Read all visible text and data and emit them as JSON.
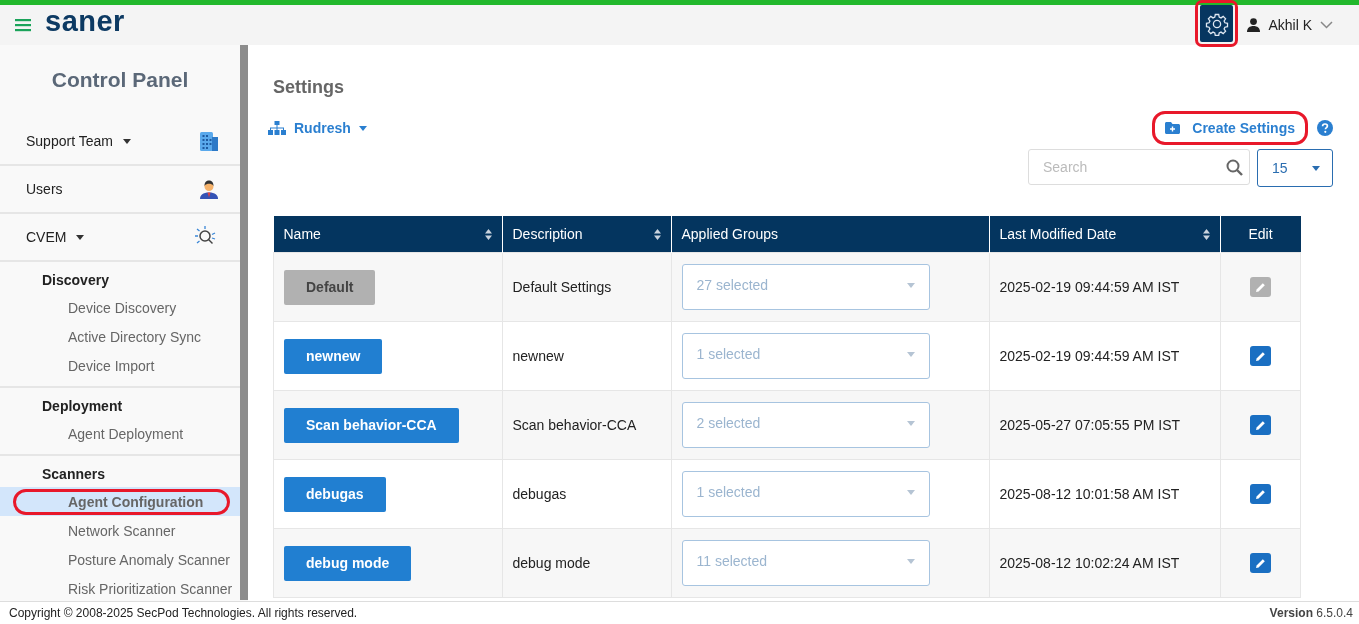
{
  "header": {
    "logo": "saner",
    "settings_highlighted": true,
    "user": "Akhil K"
  },
  "sidebar": {
    "title": "Control Panel",
    "items": [
      {
        "label": "Support Team",
        "caret": true,
        "selected": false
      },
      {
        "label": "Users",
        "caret": false,
        "selected": false
      },
      {
        "label": "CVEM",
        "caret": true,
        "selected": false
      }
    ],
    "groups": [
      {
        "label": "Discovery",
        "children": [
          {
            "label": "Device Discovery",
            "selected": false,
            "highlighted": false
          },
          {
            "label": "Active Directory Sync",
            "selected": false,
            "highlighted": false
          },
          {
            "label": "Device Import",
            "selected": false,
            "highlighted": false
          }
        ]
      },
      {
        "label": "Deployment",
        "children": [
          {
            "label": "Agent Deployment",
            "selected": false,
            "highlighted": false
          }
        ]
      },
      {
        "label": "Scanners",
        "children": [
          {
            "label": "Agent Configuration",
            "selected": true,
            "highlighted": true
          },
          {
            "label": "Network Scanner",
            "selected": false,
            "highlighted": false
          },
          {
            "label": "Posture Anomaly Scanner",
            "selected": false,
            "highlighted": false
          },
          {
            "label": "Risk Prioritization Scanner",
            "selected": false,
            "highlighted": false
          }
        ]
      }
    ]
  },
  "page": {
    "title": "Settings",
    "group": "Rudresh",
    "create_button": "Create Settings",
    "create_highlighted": true,
    "search": {
      "placeholder": "Search"
    },
    "page_size": "15"
  },
  "table": {
    "columns": [
      {
        "label": "Name",
        "sortable": true
      },
      {
        "label": "Description",
        "sortable": true
      },
      {
        "label": "Applied Groups",
        "sortable": false
      },
      {
        "label": "Last Modified Date",
        "sortable": true
      },
      {
        "label": "Edit",
        "sortable": false
      }
    ],
    "rows": [
      {
        "name": "Default",
        "disabled": true,
        "description": "Default Settings",
        "groups": "27 selected",
        "date": "2025-02-19 09:44:59 AM IST"
      },
      {
        "name": "newnew",
        "disabled": false,
        "description": "newnew",
        "groups": "1 selected",
        "date": "2025-02-19 09:44:59 AM IST"
      },
      {
        "name": "Scan behavior-CCA",
        "disabled": false,
        "description": "Scan behavior-CCA",
        "groups": "2 selected",
        "date": "2025-05-27 07:05:55 PM IST"
      },
      {
        "name": "debugas",
        "disabled": false,
        "description": "debugas",
        "groups": "1 selected",
        "date": "2025-08-12 10:01:58 AM IST"
      },
      {
        "name": "debug mode",
        "disabled": false,
        "description": "debug mode",
        "groups": "11 selected",
        "date": "2025-08-12 10:02:24 AM IST"
      }
    ]
  },
  "footer": {
    "copyright": "Copyright © 2008-2025 SecPod Technologies. All rights reserved.",
    "version_label": "Version",
    "version": "6.5.0.4"
  }
}
